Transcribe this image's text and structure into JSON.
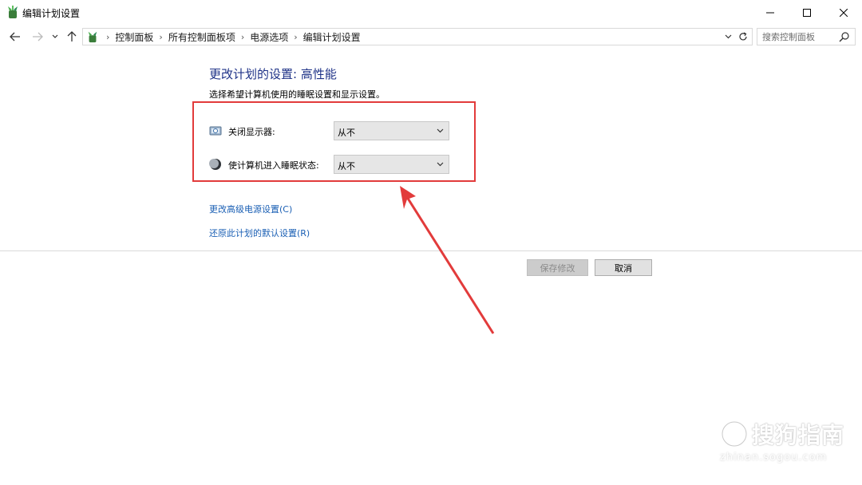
{
  "window": {
    "title": "编辑计划设置",
    "icon": "power-options-icon",
    "controls": [
      "minimize-icon",
      "maximize-icon",
      "close-icon"
    ]
  },
  "navigation": {
    "breadcrumbs": [
      "控制面板",
      "所有控制面板项",
      "电源选项",
      "编辑计划设置"
    ],
    "search_placeholder": "搜索控制面板"
  },
  "main": {
    "title": "更改计划的设置: 高性能",
    "subtitle": "选择希望计算机使用的睡眠设置和显示设置。",
    "settings": [
      {
        "label": "关闭显示器:",
        "value": "从不",
        "icon": "display-icon"
      },
      {
        "label": "使计算机进入睡眠状态:",
        "value": "从不",
        "icon": "sleep-moon-icon"
      }
    ],
    "links": [
      "更改高级电源设置(C)",
      "还原此计划的默认设置(R)"
    ],
    "buttons": {
      "save": "保存修改",
      "cancel": "取消"
    }
  },
  "annotation": {
    "box_color": "#e23b3b",
    "arrow_color": "#e23b3b"
  },
  "watermark": {
    "text": "搜狗指南",
    "url": "zhinan.sogou.com"
  },
  "colors": {
    "title": "#1e3287",
    "link": "#1a5fb4"
  }
}
